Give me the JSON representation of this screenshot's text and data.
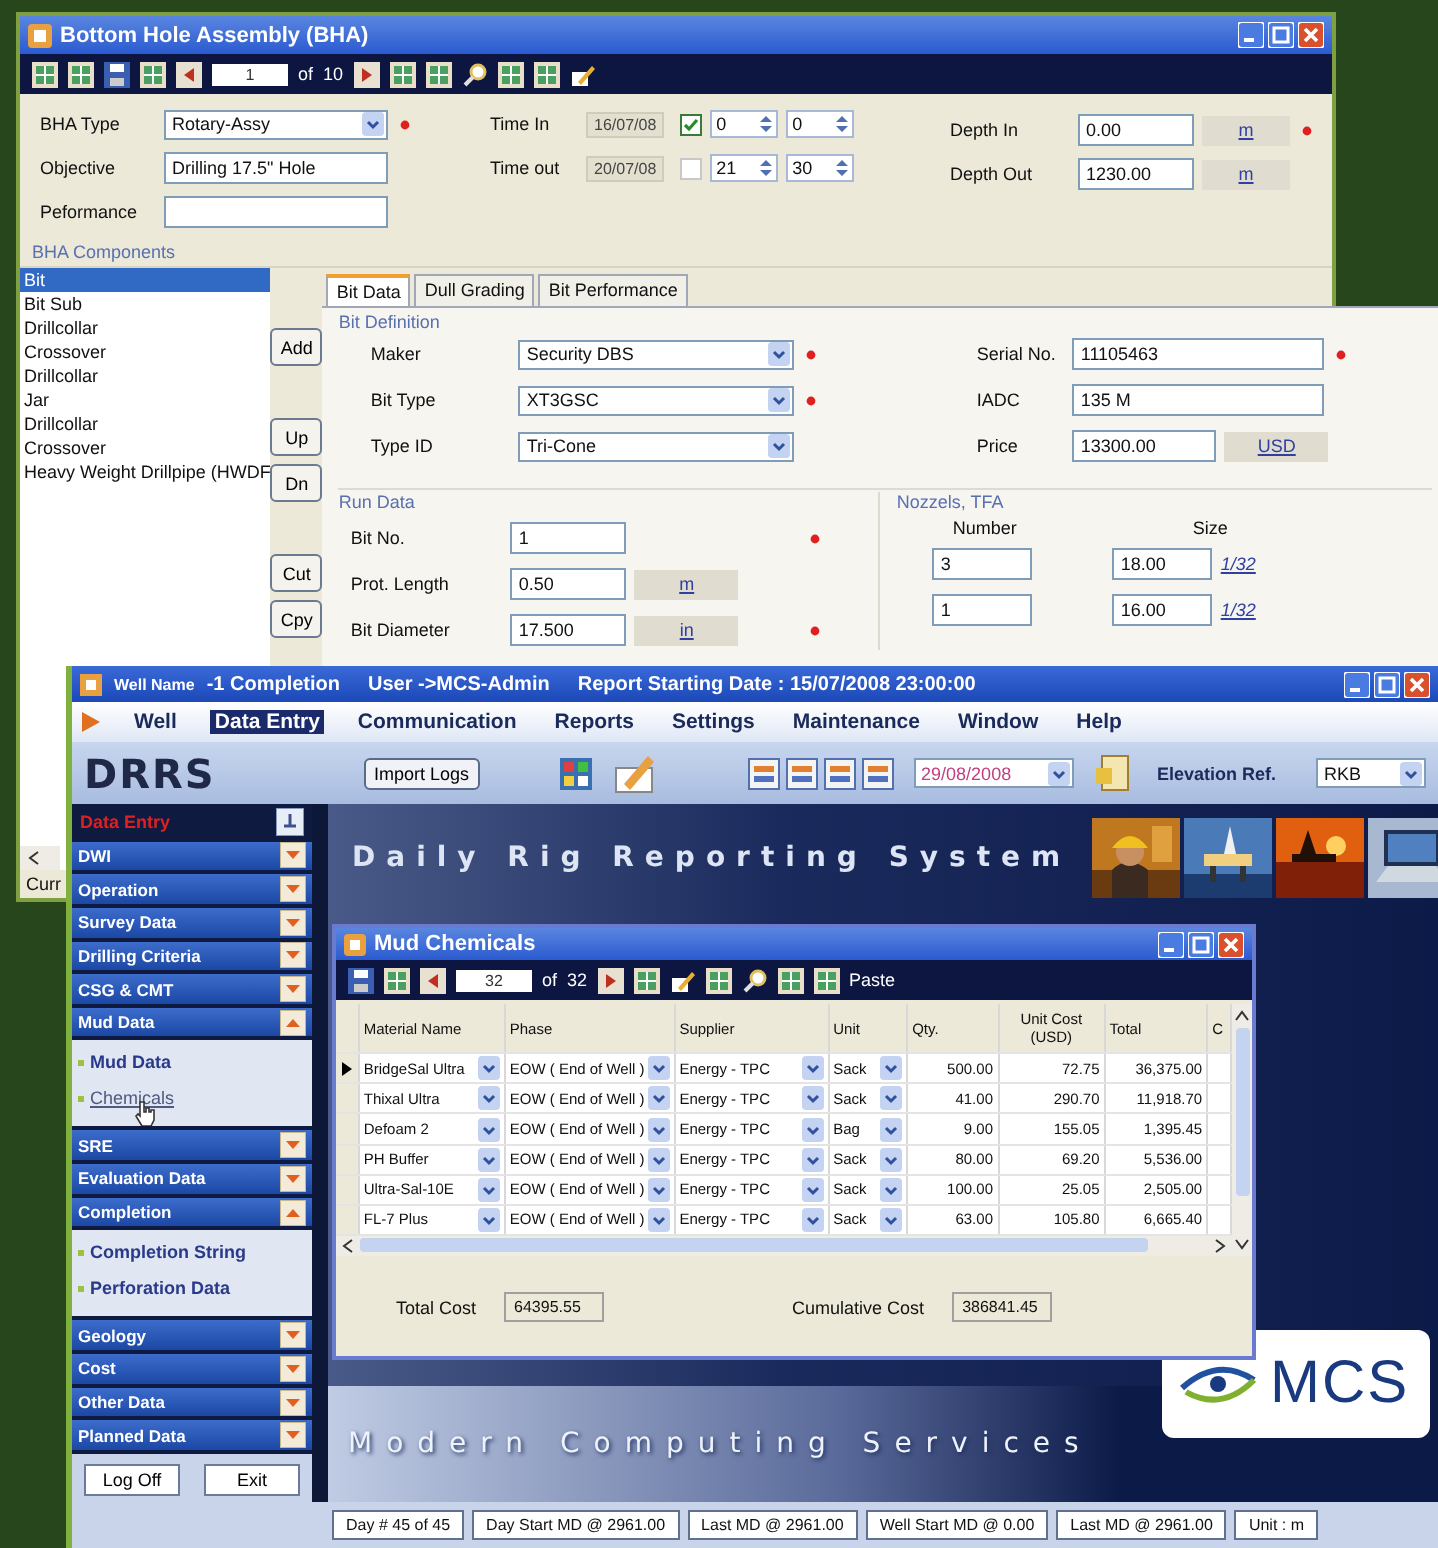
{
  "bha_window": {
    "title": "Bottom Hole Assembly (BHA)",
    "navigator": {
      "current": "1",
      "of": "of",
      "total": "10"
    },
    "bha_type": {
      "label": "BHA Type",
      "value": "Rotary-Assy",
      "required": true
    },
    "objective": {
      "label": "Objective",
      "value": "Drilling 17.5\" Hole"
    },
    "performance": {
      "label": "Peformance"
    },
    "time_in": {
      "label": "Time In",
      "date": "16/07/08",
      "checked": true,
      "hour": "0",
      "minute": "0"
    },
    "time_out": {
      "label": "Time out",
      "date": "20/07/08",
      "checked": false,
      "hour": "21",
      "minute": "30"
    },
    "depth_in": {
      "label": "Depth In",
      "value": "0.00",
      "unit": "m",
      "required": true
    },
    "depth_out": {
      "label": "Depth Out",
      "value": "1230.00",
      "unit": "m",
      "required": false
    },
    "components": {
      "label": "BHA Components",
      "items": [
        {
          "name": "Bit",
          "selected": true
        },
        {
          "name": "Bit Sub",
          "selected": false
        },
        {
          "name": "Drillcollar",
          "selected": false
        },
        {
          "name": "Crossover",
          "selected": false
        },
        {
          "name": "Drillcollar",
          "selected": false
        },
        {
          "name": "Jar",
          "selected": false
        },
        {
          "name": "Drillcollar",
          "selected": false
        },
        {
          "name": "Crossover",
          "selected": false
        },
        {
          "name": "Heavy Weight Drillpipe (HWDF",
          "selected": false
        }
      ],
      "button_groups": [
        [
          "Add"
        ],
        [
          "Up",
          "Dn"
        ],
        [
          "Cut",
          "Cpy"
        ]
      ],
      "status": "Curr"
    },
    "tabs": [
      {
        "label": "Bit Data",
        "selected": true
      },
      {
        "label": "Dull Grading",
        "selected": false
      },
      {
        "label": "Bit Performance",
        "selected": false
      }
    ],
    "bit_definition": {
      "label": "Bit Definition",
      "fields": [
        {
          "label": "Maker",
          "value": "Security DBS",
          "required": true
        },
        {
          "label": "Bit Type",
          "value": "XT3GSC",
          "required": true
        },
        {
          "label": "Type ID",
          "value": "Tri-Cone",
          "required": false
        }
      ],
      "right_fields": [
        {
          "label": "Serial No.",
          "value": "11105463",
          "required": true
        },
        {
          "label": "IADC",
          "value": "135 M"
        },
        {
          "label": "Price",
          "value": "13300.00",
          "unit": "USD"
        }
      ]
    },
    "run_data": {
      "label": "Run Data",
      "fields": [
        {
          "label": "Bit No.",
          "value": "1",
          "required": true
        },
        {
          "label": "Prot. Length",
          "value": "0.50",
          "unit": "m",
          "required": false
        },
        {
          "label": "Bit Diameter",
          "value": "17.500",
          "unit": "in",
          "required": true
        }
      ]
    },
    "nozzles": {
      "label": "Nozzels, TFA",
      "columns": [
        "Number",
        "Size"
      ],
      "rows": [
        {
          "number": "3",
          "size": "18.00",
          "unit": "1/32"
        },
        {
          "number": "1",
          "size": "16.00",
          "unit": "1/32"
        }
      ]
    }
  },
  "main_window": {
    "title": {
      "well_label": "Well Name",
      "well": "-1 Completion",
      "user": "User ->MCS-Admin",
      "report_date": "Report Starting Date : 15/07/2008 23:00:00"
    },
    "menu": [
      {
        "label": "Well",
        "selected": false
      },
      {
        "label": "Data Entry",
        "selected": true
      },
      {
        "label": "Communication",
        "selected": false
      },
      {
        "label": "Reports",
        "selected": false
      },
      {
        "label": "Settings",
        "selected": false
      },
      {
        "label": "Maintenance",
        "selected": false
      },
      {
        "label": "Window",
        "selected": false
      },
      {
        "label": "Help",
        "selected": false
      }
    ],
    "toolbar": {
      "logo": "DRRS",
      "import_button": "Import Logs",
      "date": "29/08/2008",
      "elevation_label": "Elevation Ref.",
      "elevation": "RKB"
    },
    "sidebar": {
      "header": "Data Entry",
      "sections": [
        {
          "label": "DWI",
          "expanded": false
        },
        {
          "label": "Operation",
          "expanded": false
        },
        {
          "label": "Survey Data",
          "expanded": false
        },
        {
          "label": "Drilling Criteria",
          "expanded": false
        },
        {
          "label": "CSG & CMT",
          "expanded": false
        },
        {
          "label": "Mud Data",
          "expanded": true,
          "children": [
            {
              "label": "Mud Data",
              "hovered": false
            },
            {
              "label": "Chemicals",
              "hovered": true
            }
          ]
        },
        {
          "label": "SRE",
          "expanded": false
        },
        {
          "label": "Evaluation Data",
          "expanded": false
        },
        {
          "label": "Completion",
          "expanded": true,
          "children": [
            {
              "label": "Completion String",
              "hovered": false
            },
            {
              "label": "Perforation Data",
              "hovered": false
            }
          ]
        },
        {
          "label": "Geology",
          "expanded": false
        },
        {
          "label": "Cost",
          "expanded": false
        },
        {
          "label": "Other Data",
          "expanded": false
        },
        {
          "label": "Planned Data",
          "expanded": false
        }
      ]
    },
    "banner_title": "Daily Rig Reporting System",
    "footer_title": "Modern Computing Services",
    "logo": "MCS",
    "buttons": [
      "Log Off",
      "Exit"
    ],
    "status_bar": [
      "Day # 45 of 45",
      "Day Start MD @ 2961.00",
      "Last MD @ 2961.00",
      "Well Start MD @ 0.00",
      "Last MD @ 2961.00",
      "Unit : m"
    ]
  },
  "mud_window": {
    "title": "Mud Chemicals",
    "navigator": {
      "current": "32",
      "of": "of",
      "total": "32"
    },
    "paste": "Paste",
    "columns": [
      "Material Name",
      "Phase",
      "Supplier",
      "Unit",
      "Qty.",
      "Unit Cost (USD)",
      "Total",
      "C"
    ],
    "rows": [
      {
        "material": "BridgeSal Ultra",
        "phase": "EOW ( End of Well )",
        "supplier": "Energy - TPC",
        "unit": "Sack",
        "qty": "500.00",
        "unit_cost": "72.75",
        "total": "36,375.00",
        "selected": true
      },
      {
        "material": "Thixal Ultra",
        "phase": "EOW ( End of Well )",
        "supplier": "Energy - TPC",
        "unit": "Sack",
        "qty": "41.00",
        "unit_cost": "290.70",
        "total": "11,918.70",
        "selected": false
      },
      {
        "material": "Defoam 2",
        "phase": "EOW ( End of Well )",
        "supplier": "Energy - TPC",
        "unit": "Bag",
        "qty": "9.00",
        "unit_cost": "155.05",
        "total": "1,395.45",
        "selected": false
      },
      {
        "material": "PH Buffer",
        "phase": "EOW ( End of Well )",
        "supplier": "Energy - TPC",
        "unit": "Sack",
        "qty": "80.00",
        "unit_cost": "69.20",
        "total": "5,536.00",
        "selected": false
      },
      {
        "material": "Ultra-Sal-10E",
        "phase": "EOW ( End of Well )",
        "supplier": "Energy - TPC",
        "unit": "Sack",
        "qty": "100.00",
        "unit_cost": "25.05",
        "total": "2,505.00",
        "selected": false
      },
      {
        "material": "FL-7 Plus",
        "phase": "EOW ( End of Well )",
        "supplier": "Energy - TPC",
        "unit": "Sack",
        "qty": "63.00",
        "unit_cost": "105.80",
        "total": "6,665.40",
        "selected": false
      }
    ],
    "total_cost": {
      "label": "Total Cost",
      "value": "64395.55"
    },
    "cumulative_cost": {
      "label": "Cumulative Cost",
      "value": "386841.45"
    }
  }
}
